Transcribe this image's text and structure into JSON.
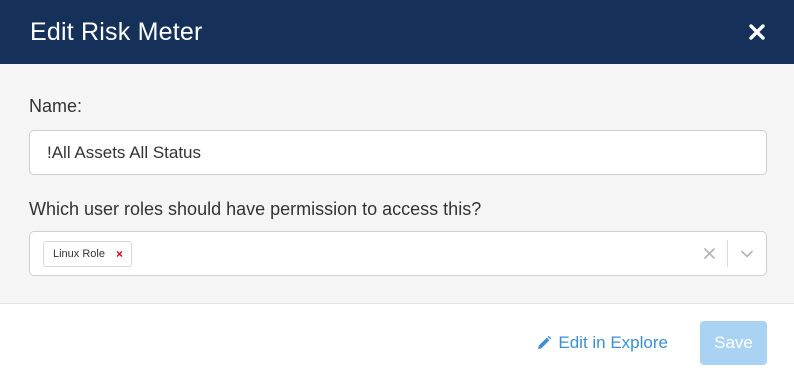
{
  "header": {
    "title": "Edit Risk Meter",
    "close_icon": "close-icon"
  },
  "form": {
    "name_label": "Name:",
    "name_value": "!All Assets All Status",
    "roles_label": "Which user roles should have permission to access this?",
    "selected_roles": [
      {
        "label": "Linux Role",
        "remove_glyph": "×"
      }
    ]
  },
  "footer": {
    "explore_label": "Edit in Explore",
    "explore_icon": "pencil-icon",
    "save_label": "Save"
  },
  "colors": {
    "header_bg": "#15315a",
    "body_bg": "#f5f5f5",
    "link": "#3b8fd4",
    "save_disabled": "#a9d2f3",
    "tag_remove": "#d0021b"
  }
}
